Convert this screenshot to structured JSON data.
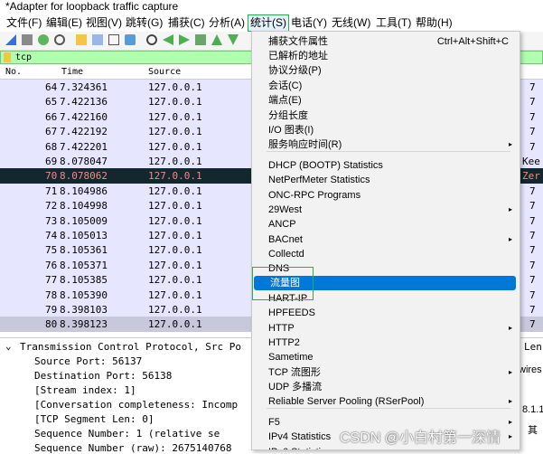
{
  "window": {
    "title": "*Adapter for loopback traffic capture"
  },
  "menubar": [
    "文件(F)",
    "编辑(E)",
    "视图(V)",
    "跳转(G)",
    "捕获(C)",
    "分析(A)",
    "统计(S)",
    "电话(Y)",
    "无线(W)",
    "工具(T)",
    "帮助(H)"
  ],
  "filter": {
    "value": "tcp"
  },
  "packet_list": {
    "columns": [
      "No.",
      "Time",
      "Source"
    ],
    "rows": [
      {
        "no": "64",
        "time": "7.324361",
        "src": "127.0.0.1",
        "end": "7"
      },
      {
        "no": "65",
        "time": "7.422136",
        "src": "127.0.0.1",
        "end": "7"
      },
      {
        "no": "66",
        "time": "7.422160",
        "src": "127.0.0.1",
        "end": "7"
      },
      {
        "no": "67",
        "time": "7.422192",
        "src": "127.0.0.1",
        "end": "7"
      },
      {
        "no": "68",
        "time": "7.422201",
        "src": "127.0.0.1",
        "end": "7"
      },
      {
        "no": "69",
        "time": "8.078047",
        "src": "127.0.0.1",
        "end": "Kee"
      },
      {
        "no": "70",
        "time": "8.078062",
        "src": "127.0.0.1",
        "end": "Zer"
      },
      {
        "no": "71",
        "time": "8.104986",
        "src": "127.0.0.1",
        "end": "7"
      },
      {
        "no": "72",
        "time": "8.104998",
        "src": "127.0.0.1",
        "end": "7"
      },
      {
        "no": "73",
        "time": "8.105009",
        "src": "127.0.0.1",
        "end": "7"
      },
      {
        "no": "74",
        "time": "8.105013",
        "src": "127.0.0.1",
        "end": "7"
      },
      {
        "no": "75",
        "time": "8.105361",
        "src": "127.0.0.1",
        "end": "7"
      },
      {
        "no": "76",
        "time": "8.105371",
        "src": "127.0.0.1",
        "end": "7"
      },
      {
        "no": "77",
        "time": "8.105385",
        "src": "127.0.0.1",
        "end": "7"
      },
      {
        "no": "78",
        "time": "8.105390",
        "src": "127.0.0.1",
        "end": "7"
      },
      {
        "no": "79",
        "time": "8.398103",
        "src": "127.0.0.1",
        "end": "7"
      },
      {
        "no": "80",
        "time": "8.398123",
        "src": "127.0.0.1",
        "end": "7"
      }
    ]
  },
  "detail": [
    "Transmission Control Protocol, Src Po",
    "Source Port: 56137",
    "Destination Port: 56138",
    "[Stream index: 1]",
    "[Conversation completeness: Incomp",
    "[TCP Segment Len: 0]",
    "Sequence Number: 1    (relative se",
    "Sequence Number (raw): 2675140768"
  ],
  "detail_right": [
    "Len",
    "wires",
    "8.1.1",
    "其"
  ],
  "stats_menu": [
    {
      "label": "捕获文件属性",
      "shortcut": "Ctrl+Alt+Shift+C"
    },
    {
      "label": "已解析的地址"
    },
    {
      "label": "协议分级(P)"
    },
    {
      "label": "会话(C)"
    },
    {
      "label": "端点(E)"
    },
    {
      "label": "分组长度"
    },
    {
      "label": "I/O 图表(I)"
    },
    {
      "label": "服务响应时间(R)",
      "submenu": true
    },
    {
      "label": "DHCP (BOOTP) Statistics"
    },
    {
      "label": "NetPerfMeter Statistics"
    },
    {
      "label": "ONC-RPC Programs"
    },
    {
      "label": "29West",
      "submenu": true
    },
    {
      "label": "ANCP"
    },
    {
      "label": "BACnet",
      "submenu": true
    },
    {
      "label": "Collectd"
    },
    {
      "label": "DNS"
    },
    {
      "label": "流量图",
      "highlight": true
    },
    {
      "label": "HART-IP"
    },
    {
      "label": "HPFEEDS"
    },
    {
      "label": "HTTP",
      "submenu": true
    },
    {
      "label": "HTTP2"
    },
    {
      "label": "Sametime"
    },
    {
      "label": "TCP 流图形",
      "submenu": true
    },
    {
      "label": "UDP 多播流"
    },
    {
      "label": "Reliable Server Pooling (RSerPool)",
      "submenu": true
    },
    {
      "label": "F5",
      "submenu": true
    },
    {
      "label": "IPv4 Statistics",
      "submenu": true
    },
    {
      "label": "IPv6 Statistics",
      "submenu": true
    }
  ],
  "watermark": "CSDN @小白村第一深情",
  "colors": {
    "accent": "#0078d7",
    "selected_row": "#12272e",
    "row_bg": "#e7e6ff",
    "filter_ok": "#afffaf",
    "annotation": "#22b14c"
  }
}
